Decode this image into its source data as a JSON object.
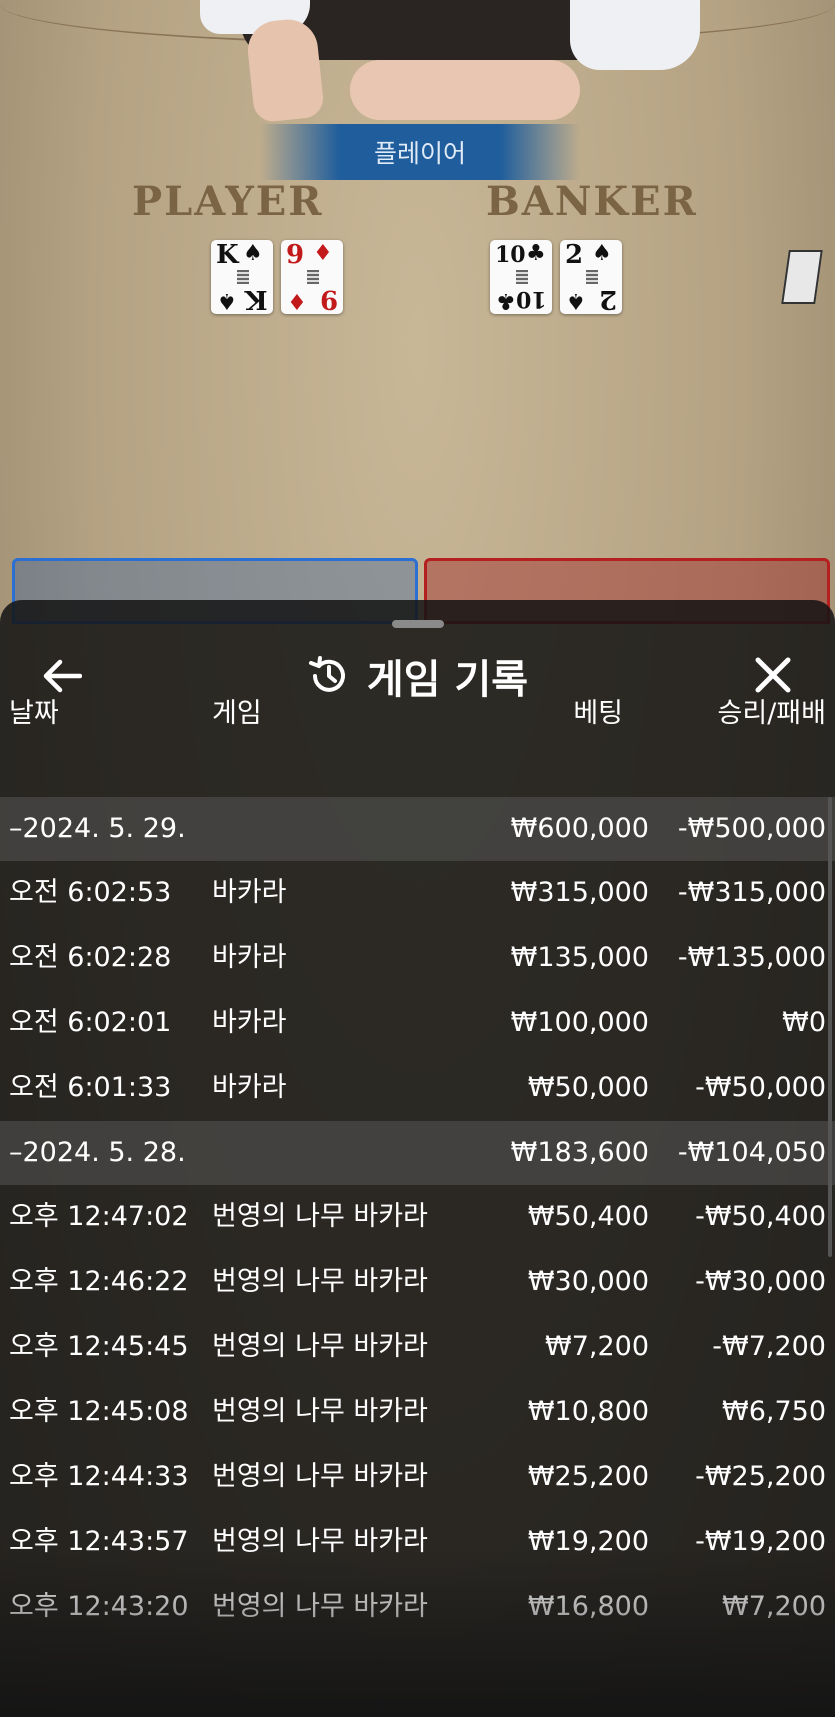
{
  "game": {
    "result_banner": "플레이어",
    "player_label": "PLAYER",
    "banker_label": "BANKER",
    "player_cards": [
      {
        "rank": "K",
        "suit": "♠",
        "color": "black"
      },
      {
        "rank": "9",
        "suit": "♦",
        "color": "red"
      }
    ],
    "banker_cards": [
      {
        "rank": "10",
        "suit": "♣",
        "color": "black"
      },
      {
        "rank": "2",
        "suit": "♠",
        "color": "black"
      }
    ]
  },
  "sheet": {
    "title": "게임 기록",
    "back_icon": "arrow-left-icon",
    "history_icon": "history-icon",
    "close_icon": "close-icon",
    "columns": {
      "date": "날짜",
      "game": "게임",
      "bet": "베팅",
      "win_loss": "승리/패배"
    },
    "groups": [
      {
        "date": "–2024. 5. 29.",
        "bet": "₩600,000",
        "win_loss": "-₩500,000",
        "rows": [
          {
            "time": "오전 6:02:53",
            "game": "바카라",
            "bet": "₩315,000",
            "win_loss": "-₩315,000"
          },
          {
            "time": "오전 6:02:28",
            "game": "바카라",
            "bet": "₩135,000",
            "win_loss": "-₩135,000"
          },
          {
            "time": "오전 6:02:01",
            "game": "바카라",
            "bet": "₩100,000",
            "win_loss": "₩0"
          },
          {
            "time": "오전 6:01:33",
            "game": "바카라",
            "bet": "₩50,000",
            "win_loss": "-₩50,000"
          }
        ]
      },
      {
        "date": "–2024. 5. 28.",
        "bet": "₩183,600",
        "win_loss": "-₩104,050",
        "rows": [
          {
            "time": "오후 12:47:02",
            "game": "번영의 나무 바카라",
            "bet": "₩50,400",
            "win_loss": "-₩50,400"
          },
          {
            "time": "오후 12:46:22",
            "game": "번영의 나무 바카라",
            "bet": "₩30,000",
            "win_loss": "-₩30,000"
          },
          {
            "time": "오후 12:45:45",
            "game": "번영의 나무 바카라",
            "bet": "₩7,200",
            "win_loss": "-₩7,200"
          },
          {
            "time": "오후 12:45:08",
            "game": "번영의 나무 바카라",
            "bet": "₩10,800",
            "win_loss": "₩6,750"
          },
          {
            "time": "오후 12:44:33",
            "game": "번영의 나무 바카라",
            "bet": "₩25,200",
            "win_loss": "-₩25,200"
          },
          {
            "time": "오후 12:43:57",
            "game": "번영의 나무 바카라",
            "bet": "₩19,200",
            "win_loss": "-₩19,200"
          },
          {
            "time": "오후 12:43:20",
            "game": "번영의 나무 바카라",
            "bet": "₩16,800",
            "win_loss": "₩7,200"
          }
        ]
      }
    ]
  },
  "colors": {
    "player_blue": "#1f5d9c",
    "banker_red": "#b42020",
    "sheet_bg": "#141414",
    "group_row_bg": "#555555"
  }
}
